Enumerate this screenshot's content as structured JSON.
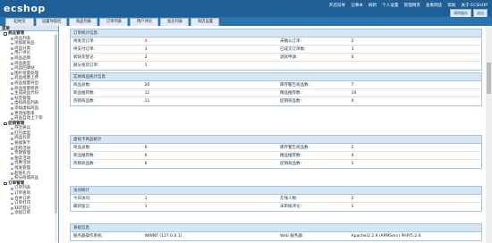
{
  "header": {
    "logo": "ecshop",
    "links": [
      "开店向导",
      "记事本",
      "刷新",
      "个人设置",
      "管理网页",
      "查看网店",
      "帮助",
      "关于 ECSHOP"
    ],
    "buttons": [
      "清除缓存",
      "退出"
    ]
  },
  "nav": {
    "tabs": [
      "起始页",
      "设置导航栏",
      "商品列表",
      "订单列表",
      "用户评论",
      "会员列表",
      "商店设置"
    ]
  },
  "sidebar": {
    "title": "菜单",
    "groups": [
      {
        "label": "商品管理",
        "items": [
          "商品列表",
          "添加新商品",
          "商品分类",
          "用户评论",
          "商品品牌",
          "商品类型",
          "商品回收站",
          "图片批量处理",
          "商品批量上传",
          "商品批量导出",
          "商品批量修改",
          "生成商品代码",
          "标签管理",
          "虚拟商品列表",
          "添加虚拟商品",
          "更改加密串",
          "商品自动上下架"
        ]
      },
      {
        "label": "促销管理",
        "items": [
          "夺宝奇兵",
          "红包类型",
          "商品包装",
          "祝福贺卡",
          "团购活动",
          "专题管理",
          "拍卖活动",
          "优惠活动",
          "批发管理",
          "超值礼包",
          "积分商城商品"
        ]
      },
      {
        "label": "订单管理",
        "items": [
          "订单列表",
          "订单查询",
          "合并订单",
          "订单打印",
          "缺货登记",
          "添加订单"
        ]
      }
    ]
  },
  "panels": {
    "orders": {
      "title": "订单统计信息",
      "rows": [
        [
          "待发货订单:",
          "4",
          "未确认订单:",
          "2"
        ],
        [
          "待支付订单:",
          "3",
          "已成交订单数:",
          "3"
        ],
        [
          "新缺货登记:",
          "2",
          "退款申请:",
          "0"
        ],
        [
          "部分发货订单:",
          "1",
          "",
          ""
        ]
      ]
    },
    "goods": {
      "title": "实体商品统计信息",
      "rows": [
        [
          "商品总数:",
          "20",
          "库存警告商品数:",
          "7"
        ],
        [
          "新品推荐数:",
          "11",
          "精品推荐数:",
          "10"
        ],
        [
          "热销商品数:",
          "11",
          "促销商品数:",
          "0"
        ]
      ]
    },
    "virtual": {
      "title": "虚拟卡商品统计",
      "rows": [
        [
          "商品总数:",
          "6",
          "库存警告商品数:",
          "2"
        ],
        [
          "新品推荐数:",
          "6",
          "精品推荐数:",
          "4"
        ],
        [
          "热销商品数:",
          "6",
          "促销商品数:",
          "1"
        ]
      ]
    },
    "visits": {
      "title": "访问统计",
      "rows": [
        [
          "今日访问:",
          "1",
          "在线人数:",
          "2"
        ],
        [
          "最新留言:",
          "1",
          "未审核评论:",
          "1"
        ]
      ]
    },
    "system": {
      "title": "系统信息",
      "rows": [
        [
          "服务器操作系统:",
          "WINNT (127.0.0.1)",
          "Web 服务器:",
          "Apache/2.2.9 (APMServ) PHP/5.2.6"
        ]
      ]
    }
  },
  "colors": {
    "topbar": "#1f5f96",
    "navbar": "#2a74ad",
    "panel_header": "#d8e6f3",
    "alert": "#ee0000"
  }
}
